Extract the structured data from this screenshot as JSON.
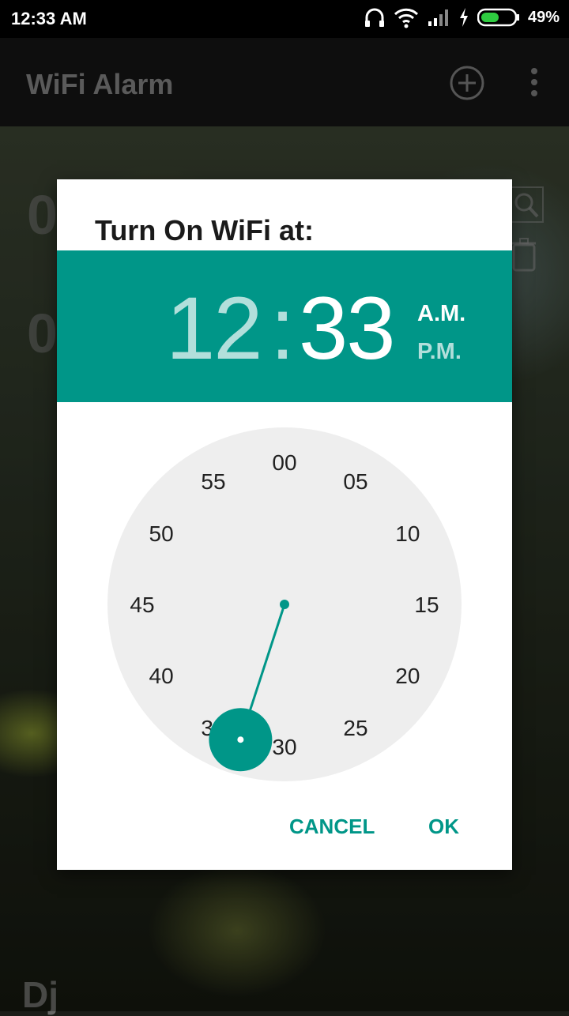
{
  "status_bar": {
    "time": "12:33 AM",
    "battery": "49%"
  },
  "app_bar": {
    "title": "WiFi Alarm"
  },
  "background": {
    "peek_digit_1": "0",
    "peek_digit_2": "0",
    "peek_bottom": "Dj"
  },
  "dialog": {
    "title": "Turn On WiFi at:",
    "hour": "12",
    "colon": ":",
    "minute": "33",
    "am_label": "A.M.",
    "pm_label": "P.M.",
    "selected_minute": 33,
    "clock_labels": [
      "00",
      "05",
      "10",
      "15",
      "20",
      "25",
      "30",
      "35",
      "40",
      "45",
      "50",
      "55"
    ],
    "cancel_label": "CANCEL",
    "ok_label": "OK"
  },
  "colors": {
    "accent": "#009688",
    "accent_light": "#b2dfdb",
    "dial_bg": "#eeeeee"
  }
}
